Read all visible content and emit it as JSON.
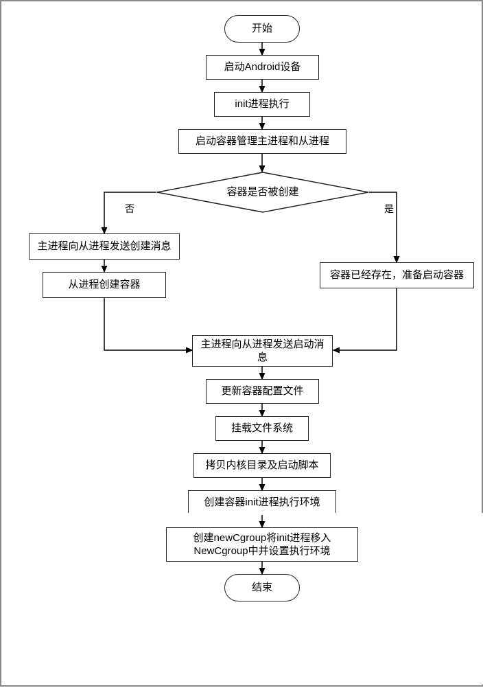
{
  "chart_data": {
    "type": "flowchart",
    "nodes": [
      {
        "id": "start",
        "kind": "terminator",
        "label": "开始"
      },
      {
        "id": "n1",
        "kind": "process",
        "label": "启动Android设备"
      },
      {
        "id": "n2",
        "kind": "process",
        "label": "init进程执行"
      },
      {
        "id": "n3",
        "kind": "process",
        "label": "启动容器管理主进程和从进程"
      },
      {
        "id": "d1",
        "kind": "decision",
        "label": "容器是否被创建"
      },
      {
        "id": "nL1",
        "kind": "process",
        "label": "主进程向从进程发送创建消息"
      },
      {
        "id": "nL2",
        "kind": "process",
        "label": "从进程创建容器"
      },
      {
        "id": "nR1",
        "kind": "process",
        "label": "容器已经存在，准备启动容器"
      },
      {
        "id": "n4",
        "kind": "process",
        "label": "主进程向从进程发送启动消息"
      },
      {
        "id": "n5",
        "kind": "process",
        "label": "更新容器配置文件"
      },
      {
        "id": "n6",
        "kind": "process",
        "label": "挂载文件系统"
      },
      {
        "id": "n7",
        "kind": "process",
        "label": "拷贝内核目录及启动脚本"
      },
      {
        "id": "n8",
        "kind": "process",
        "label": "创建容器init进程执行环境"
      },
      {
        "id": "n9",
        "kind": "process",
        "label": "创建newCgroup将init进程移入NewCgroup中并设置执行环境"
      },
      {
        "id": "end",
        "kind": "terminator",
        "label": "结束"
      }
    ],
    "edges": [
      {
        "from": "start",
        "to": "n1"
      },
      {
        "from": "n1",
        "to": "n2"
      },
      {
        "from": "n2",
        "to": "n3"
      },
      {
        "from": "n3",
        "to": "d1"
      },
      {
        "from": "d1",
        "to": "nL1",
        "label": "否"
      },
      {
        "from": "d1",
        "to": "nR1",
        "label": "是"
      },
      {
        "from": "nL1",
        "to": "nL2"
      },
      {
        "from": "nL2",
        "to": "n4"
      },
      {
        "from": "nR1",
        "to": "n4"
      },
      {
        "from": "n4",
        "to": "n5"
      },
      {
        "from": "n5",
        "to": "n6"
      },
      {
        "from": "n6",
        "to": "n7"
      },
      {
        "from": "n7",
        "to": "n8"
      },
      {
        "from": "n8",
        "to": "n9"
      },
      {
        "from": "n9",
        "to": "end"
      }
    ]
  },
  "edge_labels": {
    "no": "否",
    "yes": "是"
  }
}
